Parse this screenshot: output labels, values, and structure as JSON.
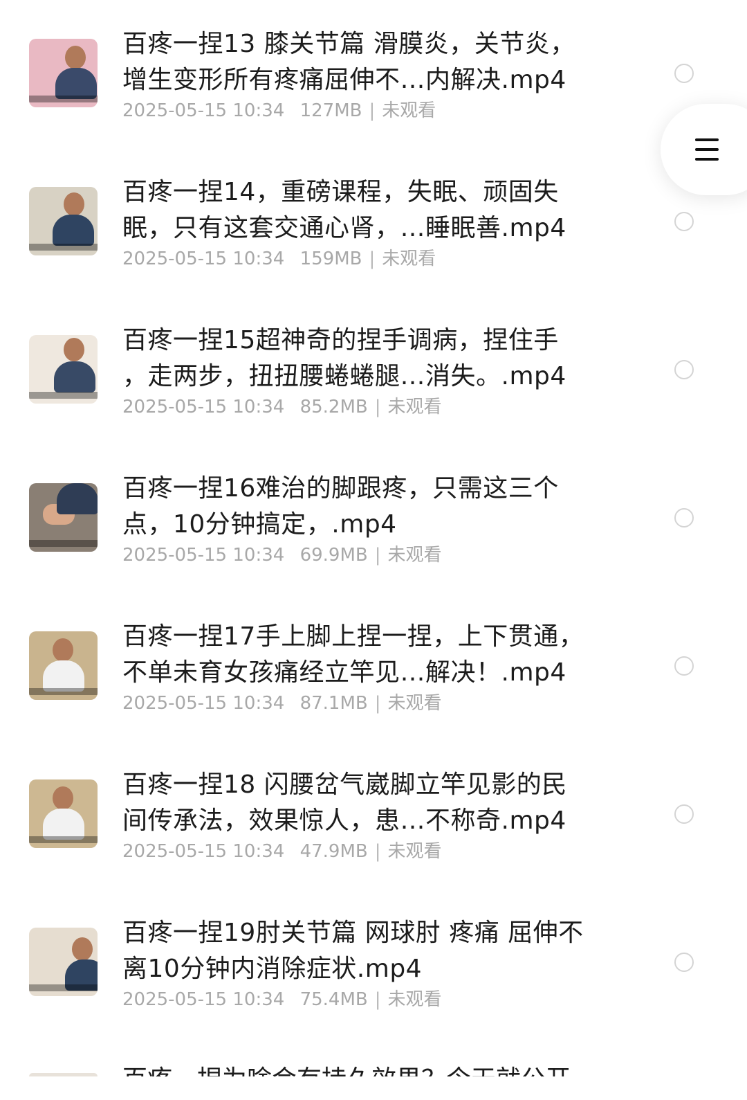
{
  "items": [
    {
      "title_line1": "百疼一捏13 膝关节篇 滑膜炎，关节炎，",
      "title_line2": "增生变形所有疼痛屈伸不…内解决.mp4",
      "date": "2025-05-15 10:34",
      "size": "127MB",
      "status": "未观看"
    },
    {
      "title_line1": "百疼一捏14，重磅课程，失眠、顽固失",
      "title_line2": "眠，只有这套交通心肾，…睡眠善.mp4",
      "date": "2025-05-15 10:34",
      "size": "159MB",
      "status": "未观看"
    },
    {
      "title_line1": "百疼一捏15超神奇的捏手调病，捏住手",
      "title_line2": "，走两步，扭扭腰蜷蜷腿…消失。.mp4",
      "date": "2025-05-15 10:34",
      "size": "85.2MB",
      "status": "未观看"
    },
    {
      "title_line1": "百疼一捏16难治的脚跟疼，只需这三个",
      "title_line2": "点，10分钟搞定，.mp4",
      "date": "2025-05-15 10:34",
      "size": "69.9MB",
      "status": "未观看"
    },
    {
      "title_line1": "百疼一捏17手上脚上捏一捏，上下贯通，",
      "title_line2": "不单未育女孩痛经立竿见…解决！.mp4",
      "date": "2025-05-15 10:34",
      "size": "87.1MB",
      "status": "未观看"
    },
    {
      "title_line1": "百疼一捏18 闪腰岔气崴脚立竿见影的民",
      "title_line2": "间传承法，效果惊人，患…不称奇.mp4",
      "date": "2025-05-15 10:34",
      "size": "47.9MB",
      "status": "未观看"
    },
    {
      "title_line1": "百疼一捏19肘关节篇 网球肘 疼痛 屈伸不",
      "title_line2": "离10分钟内消除症状.mp4",
      "date": "2025-05-15 10:34",
      "size": "75.4MB",
      "status": "未观看"
    }
  ],
  "partial_item": {
    "title_line1": "百疼一捏为啥会有持久效果？今天就公开"
  },
  "menu_button": {
    "icon": "menu-icon"
  },
  "colors": {
    "title": "#1c1c1c",
    "meta": "#a8a8a8",
    "radio_border": "#d4d4d4",
    "background": "#ffffff"
  },
  "thumbnails": [
    {
      "bg": "#e9b9c3",
      "shirt": "#3a4a6a"
    },
    {
      "bg": "#d8d2c4",
      "shirt": "#2f4461"
    },
    {
      "bg": "#efe8df",
      "shirt": "#384a66"
    },
    {
      "bg": "#8a7f74",
      "shirt": "#2f3d55"
    },
    {
      "bg": "#c9b48e",
      "shirt": "#f2f2f2"
    },
    {
      "bg": "#cdb892",
      "shirt": "#f2f2f2"
    },
    {
      "bg": "#e6ddd0",
      "shirt": "#2f4461"
    }
  ]
}
